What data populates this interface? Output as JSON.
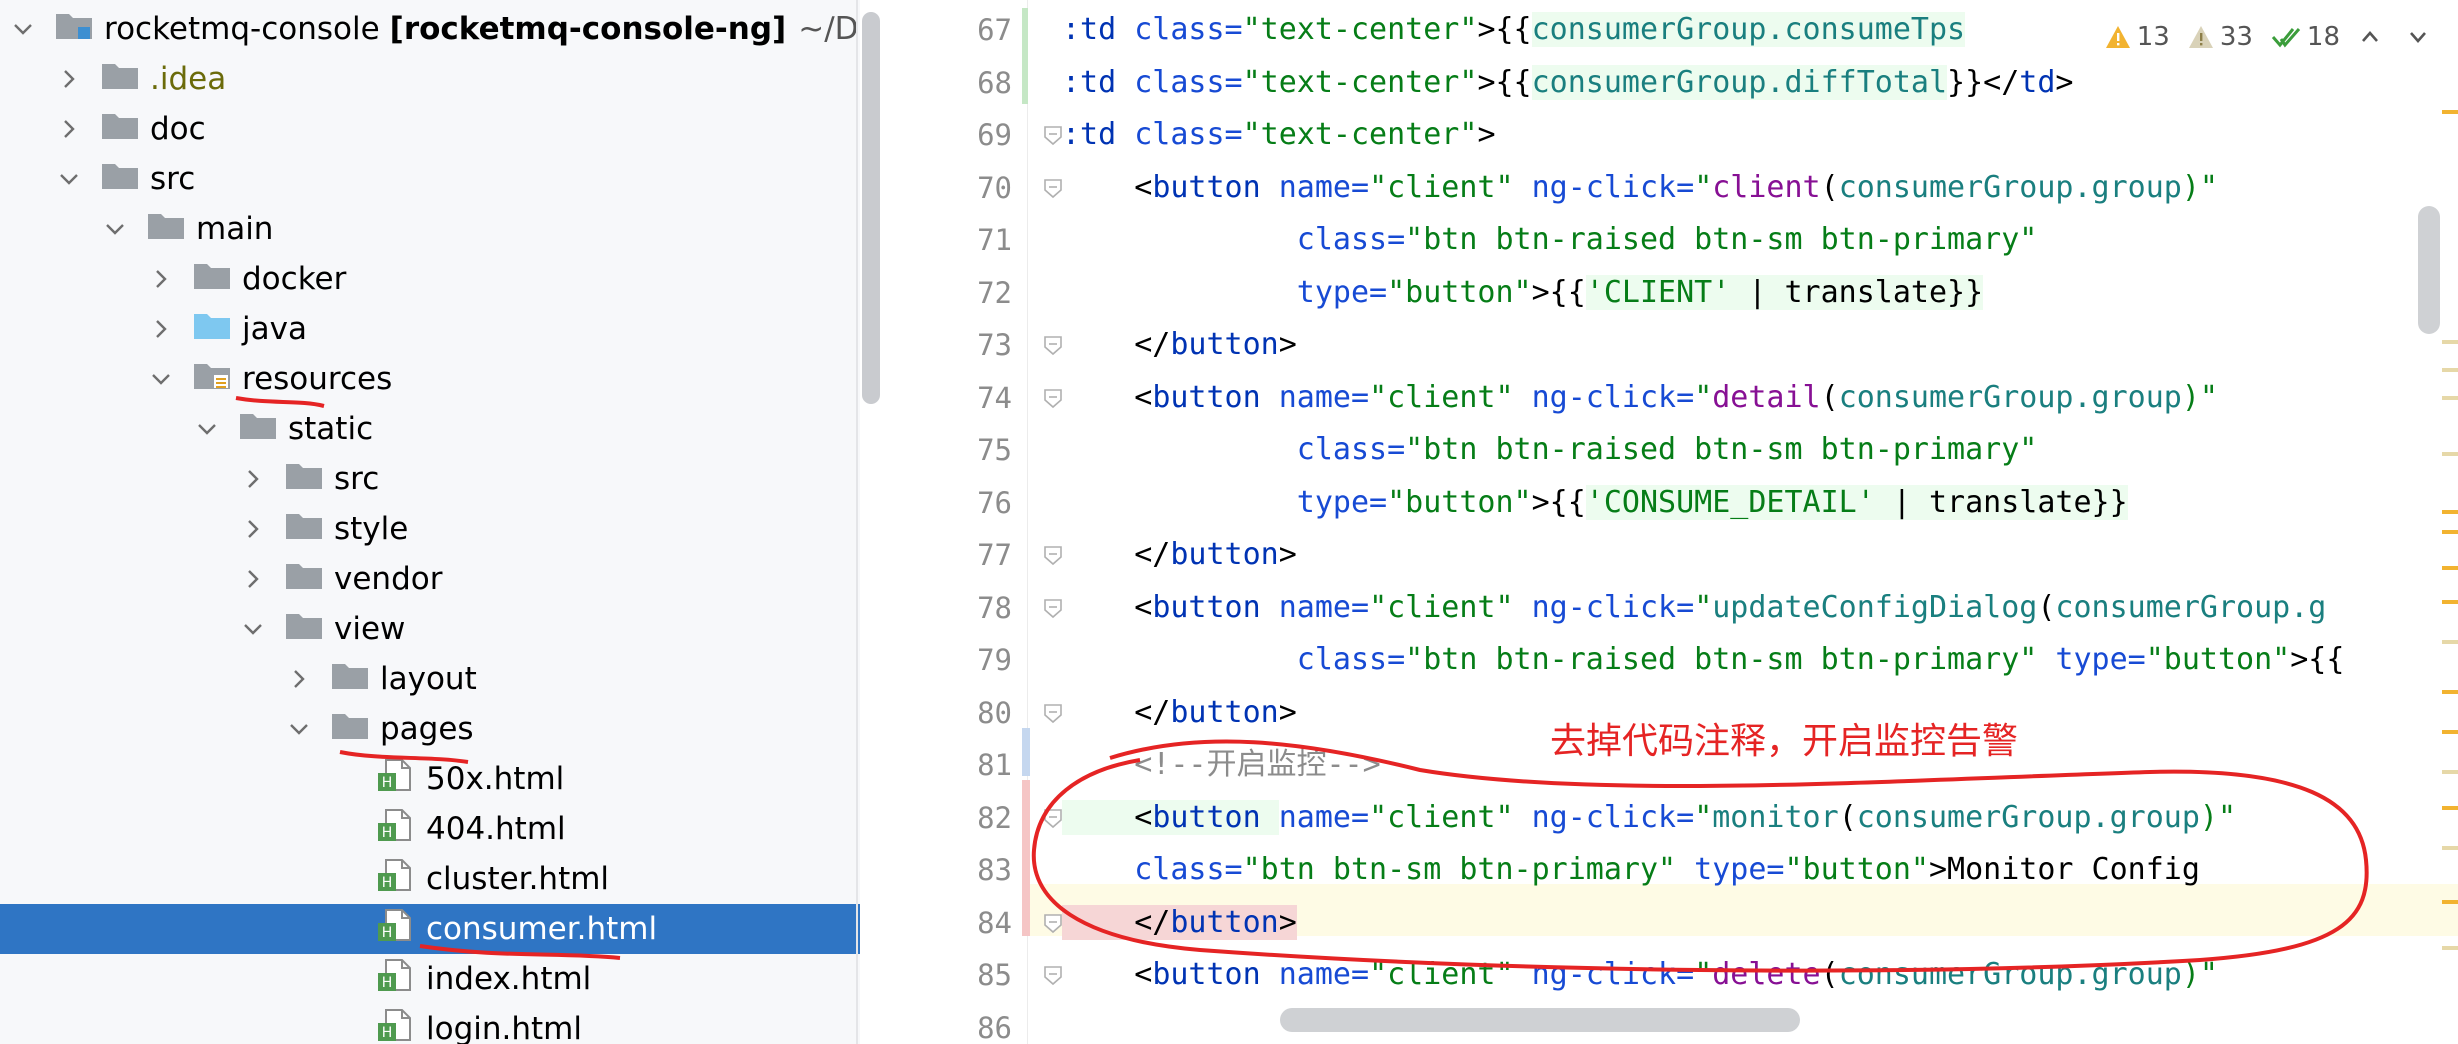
{
  "project_tree": {
    "root": {
      "name": "rocketmq-console",
      "module": "[rocketmq-console-ng]",
      "path": "~/D"
    },
    "items": [
      {
        "label": ".idea",
        "depth": 1,
        "expanded": false,
        "type": "folder"
      },
      {
        "label": "doc",
        "depth": 1,
        "expanded": false,
        "type": "folder"
      },
      {
        "label": "src",
        "depth": 1,
        "expanded": true,
        "type": "folder"
      },
      {
        "label": "main",
        "depth": 2,
        "expanded": true,
        "type": "folder"
      },
      {
        "label": "docker",
        "depth": 3,
        "expanded": false,
        "type": "folder"
      },
      {
        "label": "java",
        "depth": 3,
        "expanded": false,
        "type": "folder-blue"
      },
      {
        "label": "resources",
        "depth": 3,
        "expanded": true,
        "type": "folder-res"
      },
      {
        "label": "static",
        "depth": 4,
        "expanded": true,
        "type": "folder"
      },
      {
        "label": "src",
        "depth": 5,
        "expanded": false,
        "type": "folder"
      },
      {
        "label": "style",
        "depth": 5,
        "expanded": false,
        "type": "folder"
      },
      {
        "label": "vendor",
        "depth": 5,
        "expanded": false,
        "type": "folder"
      },
      {
        "label": "view",
        "depth": 5,
        "expanded": true,
        "type": "folder"
      },
      {
        "label": "layout",
        "depth": 6,
        "expanded": false,
        "type": "folder"
      },
      {
        "label": "pages",
        "depth": 6,
        "expanded": true,
        "type": "folder"
      },
      {
        "label": "50x.html",
        "depth": 7,
        "type": "html"
      },
      {
        "label": "404.html",
        "depth": 7,
        "type": "html"
      },
      {
        "label": "cluster.html",
        "depth": 7,
        "type": "html"
      },
      {
        "label": "consumer.html",
        "depth": 7,
        "type": "html",
        "selected": true
      },
      {
        "label": "index.html",
        "depth": 7,
        "type": "html"
      },
      {
        "label": "login.html",
        "depth": 7,
        "type": "html"
      }
    ]
  },
  "inspections": {
    "warnings": "13",
    "weak_warnings": "33",
    "typos": "18"
  },
  "editor": {
    "lines": [
      {
        "n": "67",
        "fold": false,
        "tokens": [
          [
            ":td ",
            "t-tag"
          ],
          [
            "class=",
            "t-attr"
          ],
          [
            "\"text-center\"",
            "t-str"
          ],
          [
            ">{{",
            "t-plain"
          ],
          [
            "consumerGroup.consumeTps",
            "t-var hl-green"
          ]
        ]
      },
      {
        "n": "68",
        "fold": false,
        "tokens": [
          [
            ":td ",
            "t-tag"
          ],
          [
            "class=",
            "t-attr"
          ],
          [
            "\"text-center\"",
            "t-str"
          ],
          [
            ">{{",
            "t-plain"
          ],
          [
            "consumerGroup.diffTotal",
            "t-var hl-green"
          ],
          [
            "}}</",
            "t-plain"
          ],
          [
            "td",
            "t-tag"
          ],
          [
            ">",
            "t-plain"
          ]
        ]
      },
      {
        "n": "69",
        "fold": true,
        "tokens": [
          [
            ":td ",
            "t-tag"
          ],
          [
            "class=",
            "t-attr"
          ],
          [
            "\"text-center\"",
            "t-str"
          ],
          [
            ">",
            "t-plain"
          ]
        ]
      },
      {
        "n": "70",
        "fold": true,
        "tokens": [
          [
            "    <",
            "t-plain"
          ],
          [
            "button ",
            "t-tag"
          ],
          [
            "name=",
            "t-attr"
          ],
          [
            "\"client\" ",
            "t-str"
          ],
          [
            "ng-click=",
            "t-attr"
          ],
          [
            "\"",
            "t-str"
          ],
          [
            "client",
            "t-fn"
          ],
          [
            "(",
            "t-plain"
          ],
          [
            "consumerGroup.group",
            "t-var"
          ],
          [
            ")\"",
            "t-str"
          ]
        ]
      },
      {
        "n": "71",
        "fold": false,
        "tokens": [
          [
            "             class=",
            "t-attr"
          ],
          [
            "\"btn btn-raised btn-sm btn-primary\"",
            "t-str"
          ]
        ]
      },
      {
        "n": "72",
        "fold": false,
        "tokens": [
          [
            "             type=",
            "t-attr"
          ],
          [
            "\"button\"",
            "t-str"
          ],
          [
            ">{{",
            "t-plain"
          ],
          [
            "'CLIENT'",
            "t-str hl-green"
          ],
          [
            " | translate}}",
            "t-plain hl-green"
          ]
        ]
      },
      {
        "n": "73",
        "fold": true,
        "tokens": [
          [
            "    </",
            "t-plain"
          ],
          [
            "button",
            "t-tag"
          ],
          [
            ">",
            "t-plain"
          ]
        ]
      },
      {
        "n": "74",
        "fold": true,
        "tokens": [
          [
            "    <",
            "t-plain"
          ],
          [
            "button ",
            "t-tag"
          ],
          [
            "name=",
            "t-attr"
          ],
          [
            "\"client\" ",
            "t-str"
          ],
          [
            "ng-click=",
            "t-attr"
          ],
          [
            "\"",
            "t-str"
          ],
          [
            "detail",
            "t-fn"
          ],
          [
            "(",
            "t-plain"
          ],
          [
            "consumerGroup.group",
            "t-var"
          ],
          [
            ")\"",
            "t-str"
          ]
        ]
      },
      {
        "n": "75",
        "fold": false,
        "tokens": [
          [
            "             class=",
            "t-attr"
          ],
          [
            "\"btn btn-raised btn-sm btn-primary\"",
            "t-str"
          ]
        ]
      },
      {
        "n": "76",
        "fold": false,
        "tokens": [
          [
            "             type=",
            "t-attr"
          ],
          [
            "\"button\"",
            "t-str"
          ],
          [
            ">{{",
            "t-plain"
          ],
          [
            "'CONSUME_DETAIL'",
            "t-str hl-green"
          ],
          [
            " | translate}}",
            "t-plain hl-green"
          ]
        ]
      },
      {
        "n": "77",
        "fold": true,
        "tokens": [
          [
            "    </",
            "t-plain"
          ],
          [
            "button",
            "t-tag"
          ],
          [
            ">",
            "t-plain"
          ]
        ]
      },
      {
        "n": "78",
        "fold": true,
        "tokens": [
          [
            "    <",
            "t-plain"
          ],
          [
            "button ",
            "t-tag"
          ],
          [
            "name=",
            "t-attr"
          ],
          [
            "\"client\" ",
            "t-str"
          ],
          [
            "ng-click=",
            "t-attr"
          ],
          [
            "\"",
            "t-str"
          ],
          [
            "updateConfigDialog",
            "t-var"
          ],
          [
            "(",
            "t-plain"
          ],
          [
            "consumerGroup.g",
            "t-var"
          ]
        ]
      },
      {
        "n": "79",
        "fold": false,
        "tokens": [
          [
            "             class=",
            "t-attr"
          ],
          [
            "\"btn btn-raised btn-sm btn-primary\" ",
            "t-str"
          ],
          [
            "type=",
            "t-attr"
          ],
          [
            "\"button\"",
            "t-str"
          ],
          [
            ">{{",
            "t-plain"
          ]
        ]
      },
      {
        "n": "80",
        "fold": true,
        "tokens": [
          [
            "    </",
            "t-plain"
          ],
          [
            "button",
            "t-tag"
          ],
          [
            ">",
            "t-plain"
          ]
        ]
      },
      {
        "n": "81",
        "fold": false,
        "tokens": [
          [
            "    <!--开启监控-->",
            "t-comment"
          ]
        ]
      },
      {
        "n": "82",
        "fold": true,
        "tokens": [
          [
            "    <",
            "t-plain hl-green"
          ],
          [
            "button ",
            "t-tag hl-green"
          ],
          [
            "name=",
            "t-attr"
          ],
          [
            "\"client\" ",
            "t-str"
          ],
          [
            "ng-click=",
            "t-attr"
          ],
          [
            "\"",
            "t-str"
          ],
          [
            "monitor",
            "t-var"
          ],
          [
            "(",
            "t-plain"
          ],
          [
            "consumerGroup.group",
            "t-var"
          ],
          [
            ")\"",
            "t-str"
          ]
        ]
      },
      {
        "n": "83",
        "fold": false,
        "tokens": [
          [
            "    class=",
            "t-attr"
          ],
          [
            "\"btn btn-sm btn-primary\" ",
            "t-str"
          ],
          [
            "type=",
            "t-attr"
          ],
          [
            "\"button\"",
            "t-str"
          ],
          [
            ">Monitor Config",
            "t-plain"
          ]
        ]
      },
      {
        "n": "84",
        "fold": true,
        "tokens": [
          [
            "    </",
            "t-plain hl-bracket"
          ],
          [
            "button",
            "t-tag hl-bracket"
          ],
          [
            ">",
            "t-plain hl-bracket"
          ]
        ]
      },
      {
        "n": "85",
        "fold": true,
        "tokens": [
          [
            "    <",
            "t-plain"
          ],
          [
            "button ",
            "t-tag"
          ],
          [
            "name=",
            "t-attr"
          ],
          [
            "\"client\" ",
            "t-str"
          ],
          [
            "ng-click=",
            "t-attr"
          ],
          [
            "\"",
            "t-str"
          ],
          [
            "delete",
            "t-fn"
          ],
          [
            "(",
            "t-plain"
          ],
          [
            "consumerGroup.group",
            "t-var"
          ],
          [
            ")\"",
            "t-str"
          ]
        ]
      },
      {
        "n": "86",
        "fold": false,
        "tokens": []
      }
    ]
  },
  "annotation": {
    "note": "去掉代码注释，开启监控告警",
    "color": "#e52424"
  },
  "colors": {
    "selection": "#2f75c4",
    "folder": "#9aa0a6",
    "java_folder": "#7ec8f0",
    "html_badge": "#4f9a4f"
  }
}
